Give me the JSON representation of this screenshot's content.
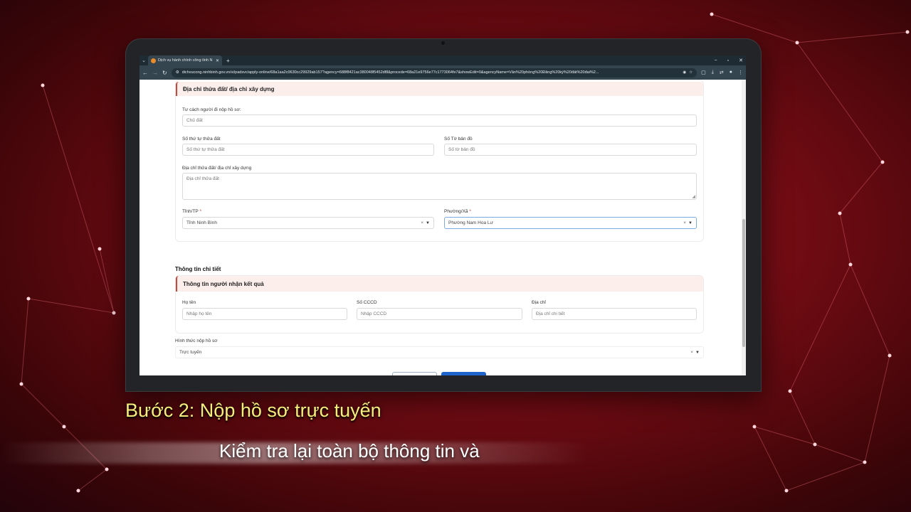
{
  "browser": {
    "tab_title": "Dịch vụ hành chính công tỉnh N",
    "url": "dichvucong.ninhbinh.gov.vn/vi/padsvc/apply-online/68a1aa2c0630cc29929ab157?agency=688f8421ac380048f5452df8&procede=68a21e9756e77c1773064fe7&showEdit=0&agencyName=Văn%20phòng%20Đăng%20ký%20đất%20đai%2..."
  },
  "land_section": {
    "header": "Địa chỉ thửa đất/ địa chỉ xây dựng",
    "applicant_role_label": "Tư cách người đi nộp hồ sơ:",
    "applicant_role_value": "Chủ đất",
    "parcel_number_label": "Số thứ tự thửa đất",
    "parcel_number_placeholder": "Số thứ tự thửa đất",
    "map_sheet_label": "Số Tờ bản đồ",
    "map_sheet_placeholder": "Số tờ bản đồ",
    "address_label": "Địa chỉ thửa đất/ địa chỉ xây dựng",
    "address_placeholder": "Địa chỉ thửa đất",
    "province_label": "Tỉnh/TP",
    "province_value": "Tỉnh Ninh Bình",
    "ward_label": "Phường/Xã",
    "ward_value": "Phường Nam Hoa Lư",
    "required_mark": "*"
  },
  "details": {
    "title": "Thông tin chi tiết",
    "recipient_header": "Thông tin người nhận kết quả",
    "name_label": "Họ tên",
    "name_placeholder": "Nhập họ tên",
    "id_label": "Số CCCD",
    "id_placeholder": "Nhập CCCD",
    "address_label": "Địa chỉ",
    "address_placeholder": "Địa chỉ chi tiết",
    "submit_method_label": "Hình thức nộp hồ sơ",
    "submit_method_value": "Trực tuyến"
  },
  "captions": {
    "step": "Bước 2: Nộp hồ sơ trực tuyến",
    "subtitle": "Kiểm tra lại toàn bộ thông tin và"
  }
}
